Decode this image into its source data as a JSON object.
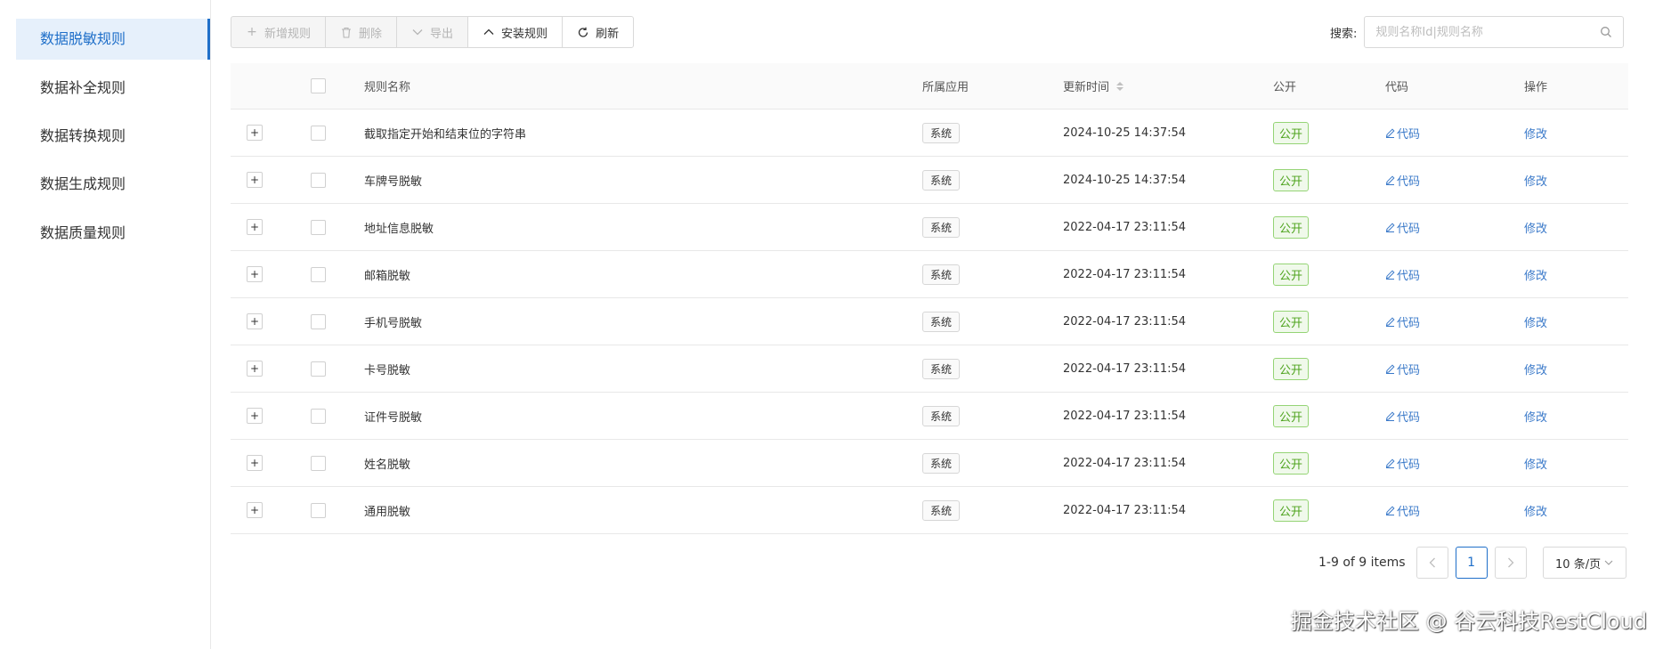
{
  "sidebar": {
    "items": [
      {
        "label": "数据脱敏规则",
        "active": true
      },
      {
        "label": "数据补全规则",
        "active": false
      },
      {
        "label": "数据转换规则",
        "active": false
      },
      {
        "label": "数据生成规则",
        "active": false
      },
      {
        "label": "数据质量规则",
        "active": false
      }
    ]
  },
  "toolbar": {
    "add_label": "新增规则",
    "delete_label": "删除",
    "export_label": "导出",
    "install_label": "安装规则",
    "refresh_label": "刷新"
  },
  "search": {
    "label": "搜索:",
    "placeholder": "规则名称Id|规则名称"
  },
  "table": {
    "headers": {
      "name": "规则名称",
      "app": "所属应用",
      "time": "更新时间",
      "public": "公开",
      "code": "代码",
      "op": "操作"
    },
    "expand_symbol": "+",
    "code_link": "代码",
    "edit_link": "修改",
    "rows": [
      {
        "name": "截取指定开始和结束位的字符串",
        "app": "系统",
        "time": "2024-10-25 14:37:54",
        "public": "公开"
      },
      {
        "name": "车牌号脱敏",
        "app": "系统",
        "time": "2024-10-25 14:37:54",
        "public": "公开"
      },
      {
        "name": "地址信息脱敏",
        "app": "系统",
        "time": "2022-04-17 23:11:54",
        "public": "公开"
      },
      {
        "name": "邮箱脱敏",
        "app": "系统",
        "time": "2022-04-17 23:11:54",
        "public": "公开"
      },
      {
        "name": "手机号脱敏",
        "app": "系统",
        "time": "2022-04-17 23:11:54",
        "public": "公开"
      },
      {
        "name": "卡号脱敏",
        "app": "系统",
        "time": "2022-04-17 23:11:54",
        "public": "公开"
      },
      {
        "name": "证件号脱敏",
        "app": "系统",
        "time": "2022-04-17 23:11:54",
        "public": "公开"
      },
      {
        "name": "姓名脱敏",
        "app": "系统",
        "time": "2022-04-17 23:11:54",
        "public": "公开"
      },
      {
        "name": "通用脱敏",
        "app": "系统",
        "time": "2022-04-17 23:11:54",
        "public": "公开"
      }
    ]
  },
  "pagination": {
    "info": "1-9 of 9 items",
    "current_page": "1",
    "page_size": "10 条/页"
  },
  "watermark": "掘金技术社区 @ 谷云科技RestCloud",
  "colors": {
    "accent": "#1f6fc9",
    "public_tag": "#4fa41f",
    "link": "#3a79c9"
  }
}
